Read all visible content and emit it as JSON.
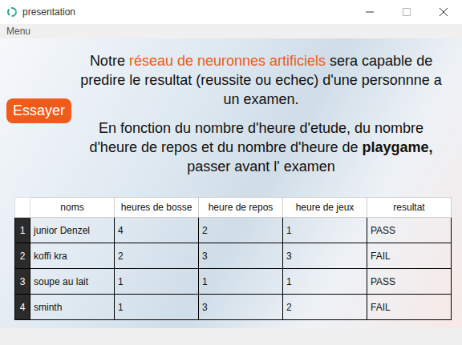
{
  "window": {
    "title": "presentation"
  },
  "menu": [
    "Menu"
  ],
  "intro": [
    [
      {
        "text": "Notre ",
        "kind": "normal"
      },
      {
        "text": "réseau de neuronnes artificiels",
        "kind": "highlight"
      },
      {
        "text": " sera capable de predire le resultat (reussite ou echec) d'une personnne a un examen.",
        "kind": "normal"
      }
    ],
    [
      {
        "text": "En fonction du nombre d'heure d'etude, du nombre d'heure de repos et du nombre d'heure de ",
        "kind": "normal"
      },
      {
        "text": "playgame,",
        "kind": "bold"
      },
      {
        "text": " passer avant l' examen",
        "kind": "normal"
      }
    ]
  ],
  "button": "Essayer",
  "table": {
    "columns": [
      "noms",
      "heures de bosse",
      "heure de repos",
      "heure de jeux",
      "resultat"
    ],
    "rows": [
      {
        "index": "1",
        "cells": [
          "junior Denzel",
          "4",
          "2",
          "1",
          "PASS"
        ]
      },
      {
        "index": "2",
        "cells": [
          "koffi kra",
          "2",
          "3",
          "3",
          "FAIL"
        ]
      },
      {
        "index": "3",
        "cells": [
          "soupe au lait",
          "1",
          "1",
          "1",
          "PASS"
        ]
      },
      {
        "index": "4",
        "cells": [
          "sminth",
          "1",
          "3",
          "2",
          "FAIL"
        ]
      }
    ]
  }
}
